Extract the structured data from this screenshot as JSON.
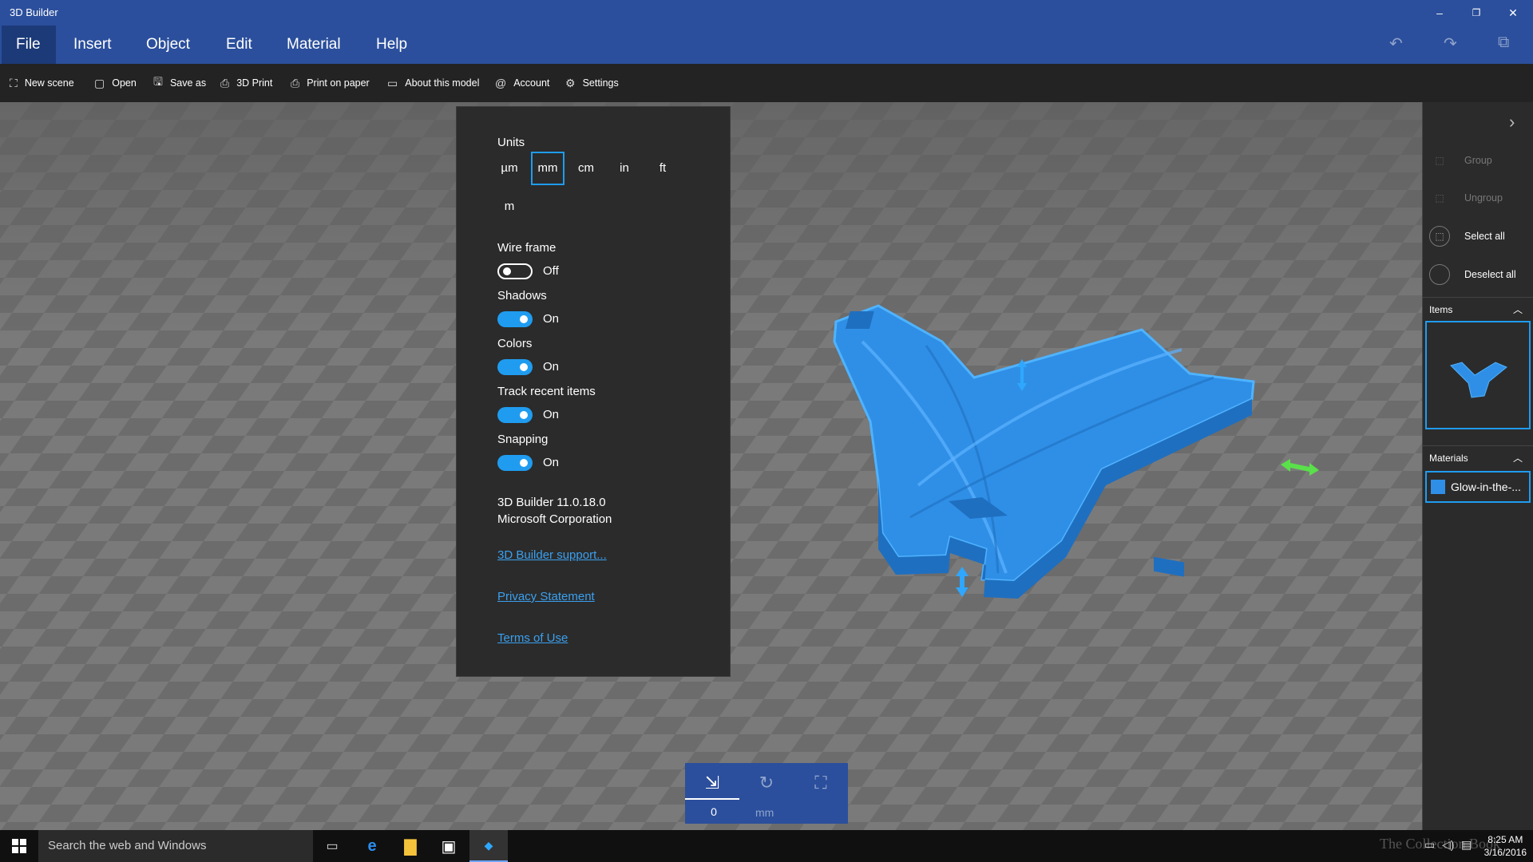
{
  "window": {
    "title": "3D Builder",
    "controls": {
      "minimize": "–",
      "restore": "❐",
      "close": "✕"
    }
  },
  "menu": [
    "File",
    "Insert",
    "Object",
    "Edit",
    "Material",
    "Help"
  ],
  "toolbar": [
    {
      "icon": "⛶",
      "label": "New scene"
    },
    {
      "icon": "▢",
      "label": "Open"
    },
    {
      "icon": "🖫",
      "label": "Save as"
    },
    {
      "icon": "⎙",
      "label": "3D Print"
    },
    {
      "icon": "⎙",
      "label": "Print on paper"
    },
    {
      "icon": "▭",
      "label": "About this model"
    },
    {
      "icon": "@",
      "label": "Account"
    },
    {
      "icon": "⚙",
      "label": "Settings"
    }
  ],
  "settings": {
    "units_label": "Units",
    "units": [
      "µm",
      "mm",
      "cm",
      "in",
      "ft",
      "m"
    ],
    "selected_unit": "mm",
    "wireframe": {
      "label": "Wire frame",
      "state": "Off"
    },
    "shadows": {
      "label": "Shadows",
      "state": "On"
    },
    "colors": {
      "label": "Colors",
      "state": "On"
    },
    "track_recent": {
      "label": "Track recent items",
      "state": "On"
    },
    "snapping": {
      "label": "Snapping",
      "state": "On"
    },
    "version": "3D Builder 11.0.18.0",
    "company": "Microsoft Corporation",
    "support_link": "3D Builder support...",
    "privacy_link": "Privacy Statement",
    "terms_link": "Terms of Use"
  },
  "right_panel": {
    "group": "Group",
    "ungroup": "Ungroup",
    "select_all": "Select all",
    "deselect_all": "Deselect all",
    "items_header": "Items",
    "materials_header": "Materials",
    "material_name": "Glow-in-the-..."
  },
  "move_control": {
    "value": "0",
    "unit": "mm"
  },
  "taskbar": {
    "search_placeholder": "Search the web and Windows",
    "time": "8:25 AM",
    "date": "3/16/2016",
    "watermark": "The Collection Book"
  },
  "colors": {
    "accent": "#1f9cf0",
    "title_bar": "#2b4f9c",
    "model": "#2f8fe6"
  }
}
